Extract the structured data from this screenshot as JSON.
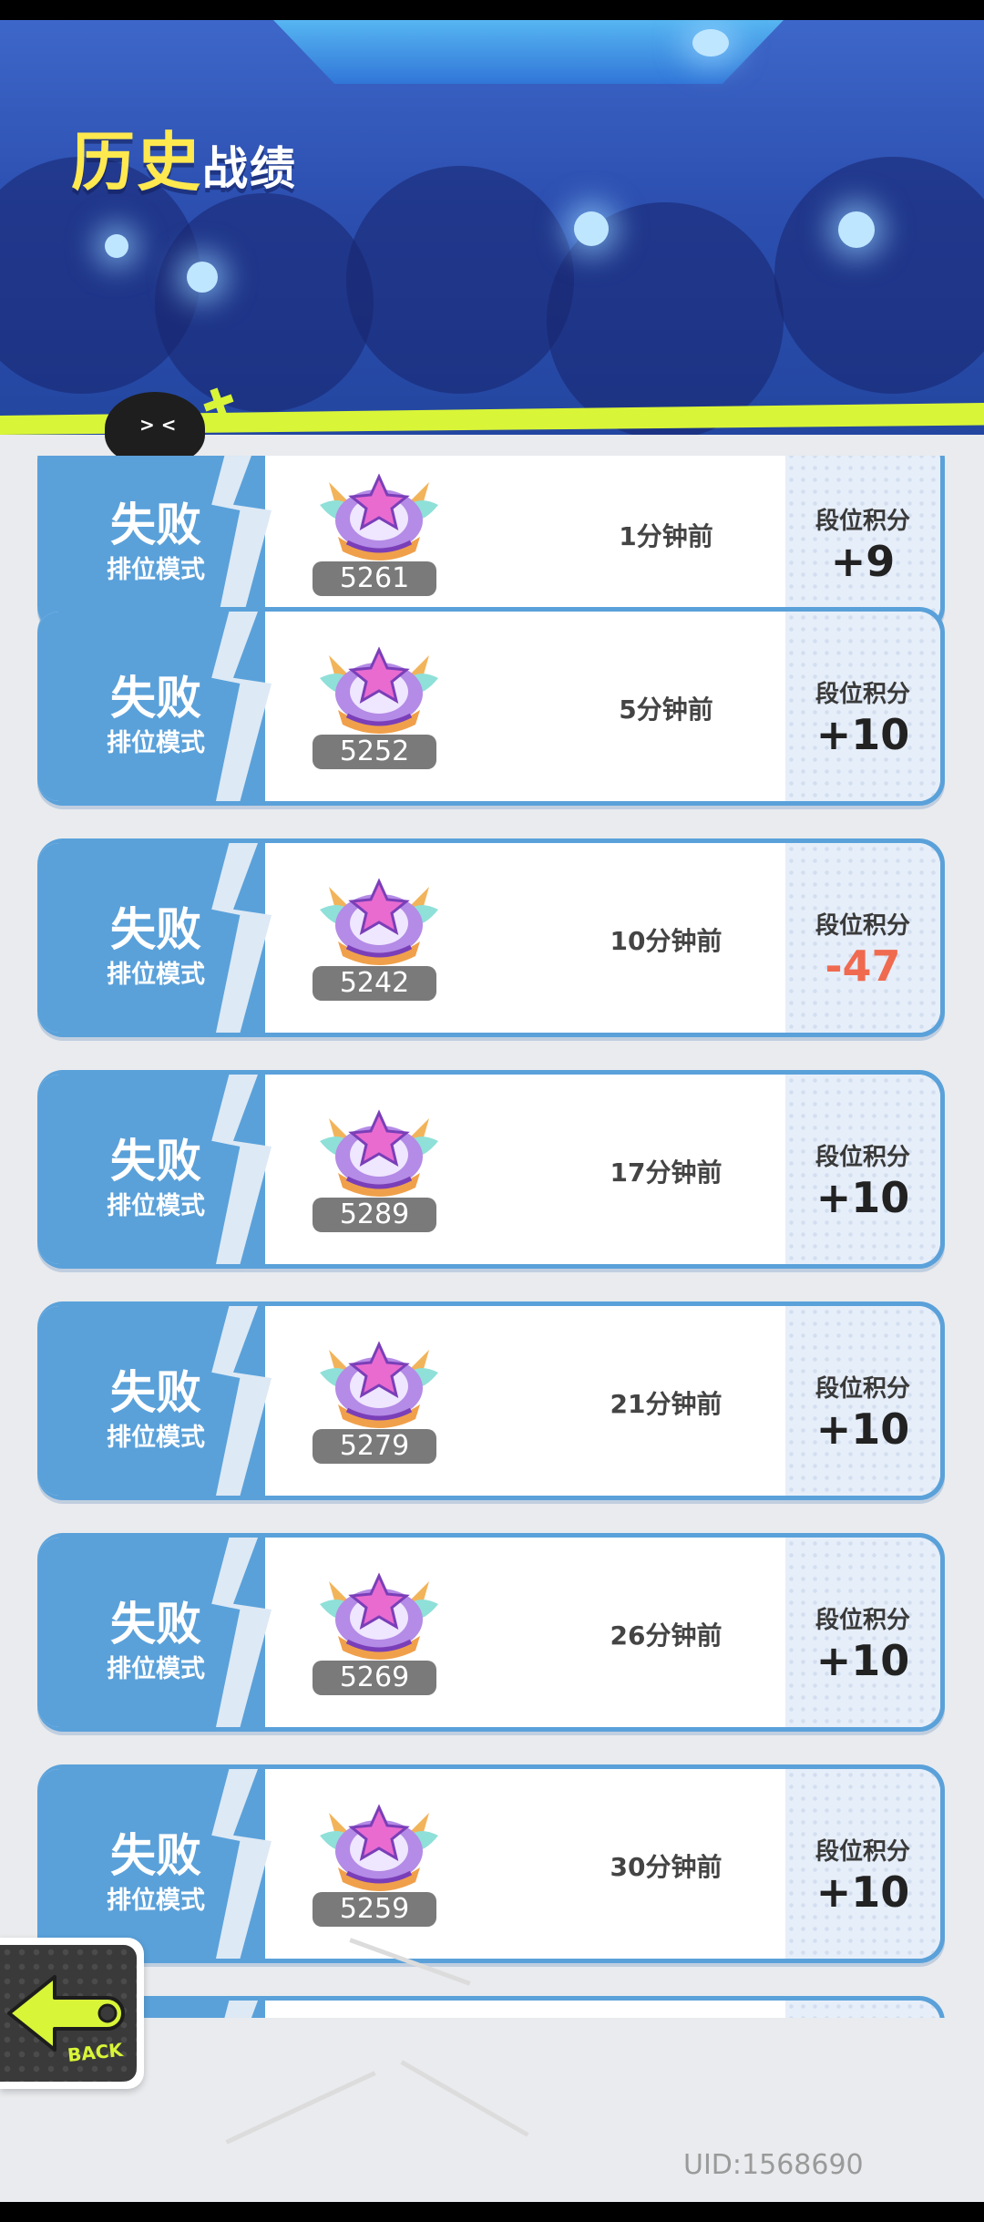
{
  "header": {
    "title_highlight": "历史",
    "title_rest": "战绩"
  },
  "score_label": "段位积分",
  "mode_label": "排位模式",
  "records": [
    {
      "result": "失败",
      "mode": "排位模式",
      "rating": "5261",
      "time": "1分钟前",
      "score_label": "段位积分",
      "score": "+9",
      "negative": false
    },
    {
      "result": "失败",
      "mode": "排位模式",
      "rating": "5252",
      "time": "5分钟前",
      "score_label": "段位积分",
      "score": "+10",
      "negative": false
    },
    {
      "result": "失败",
      "mode": "排位模式",
      "rating": "5242",
      "time": "10分钟前",
      "score_label": "段位积分",
      "score": "-47",
      "negative": true
    },
    {
      "result": "失败",
      "mode": "排位模式",
      "rating": "5289",
      "time": "17分钟前",
      "score_label": "段位积分",
      "score": "+10",
      "negative": false
    },
    {
      "result": "失败",
      "mode": "排位模式",
      "rating": "5279",
      "time": "21分钟前",
      "score_label": "段位积分",
      "score": "+10",
      "negative": false
    },
    {
      "result": "失败",
      "mode": "排位模式",
      "rating": "5269",
      "time": "26分钟前",
      "score_label": "段位积分",
      "score": "+10",
      "negative": false
    },
    {
      "result": "失败",
      "mode": "排位模式",
      "rating": "5259",
      "time": "30分钟前",
      "score_label": "段位积分",
      "score": "+10",
      "negative": false
    },
    {
      "result": "",
      "mode": "",
      "rating": "",
      "time": "",
      "score_label": "",
      "score": "",
      "negative": false
    }
  ],
  "back_button": {
    "label": "BACK",
    "icon": "arrow-left-icon"
  },
  "uid": "UID:1568690",
  "colors": {
    "accent_yellow": "#ffe94f",
    "stripe": "#d9f538",
    "card_blue": "#5aa1da",
    "negative": "#f06a4f"
  }
}
